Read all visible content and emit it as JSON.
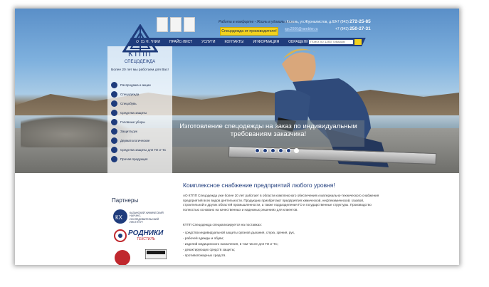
{
  "header": {
    "slogan": "Работа в комфорте - Жизнь в удовольствие",
    "manufacturer_button": "Спецодежда от производителя!",
    "address": "г.Казань, ул.Журналистов, д.62",
    "email": "spc2006@rambler.ru",
    "phones": [
      {
        "code": "+7 (843)",
        "number": "272-25-85"
      },
      {
        "code": "+7 (843)",
        "number": "250-27-31"
      }
    ]
  },
  "brand": {
    "name": "КТПП",
    "subtitle": "СПЕЦОДЕЖДА",
    "tagline": "Более 20 лет мы работаем для Вас!"
  },
  "nav": {
    "items": [
      "О КОМПАНИИ",
      "ПРАЙС-ЛИСТ",
      "УСЛУГИ",
      "КОНТАКТЫ",
      "ИНФОРМАЦИЯ",
      "ОБРАЩЕНИЕ"
    ],
    "search_placeholder": "Поиск по 1283 товарам"
  },
  "categories": [
    "Распродажа и акции",
    "Спецодежда",
    "Спецобувь",
    "Средства защиты",
    "Головные уборы",
    "Защита рук",
    "Дерматологические",
    "Средства защиты для ГО и ЧС",
    "Прочая продукция"
  ],
  "banner": {
    "text": "Изготовление спецодежды на заказ по индивидуальным требованиям заказчика!",
    "slides": 6,
    "active_slide": 6
  },
  "partners": {
    "title": "Партнеры",
    "logo1": "КАЗАНСКИЙ ХИМИЧЕСКИЙ НАУЧНО-ИССЛЕДОВАТЕЛЬСКИЙ ИНСТИТУТ",
    "logo2_main": "РОДНИКИ",
    "logo2_sub": "ТЕКСТИЛЬ"
  },
  "main": {
    "title": "Комплексное снабжение предприятий любого уровня!",
    "paragraph": "АО КТПП Спецодежда уже более 20 лет работает в области комплексного обеспечения и материально-технического снабжения предприятий всех видов деятельности. Продукцию приобретают предприятия химической, нефтехимической, газовой, строительной и других областей промышленности, а также подразделения ГО и государственные структуры. Производство полностью основано на качественных и надежных решениях для клиентов.",
    "intro": "КТПП Спецодежда специализируется на поставках:",
    "list": [
      "- средства индивидуальной защиты органов дыхания, слуха, зрения, рук,",
      "- рабочей одежды и обуви;",
      "- изделий медицинского назначения, в том числе для ГО и ЧС;",
      "- дезактирующих средств защиты;",
      "- противопожарных средств."
    ]
  },
  "colors": {
    "brand_blue": "#1f3c7c",
    "accent_yellow": "#f3d21e"
  }
}
